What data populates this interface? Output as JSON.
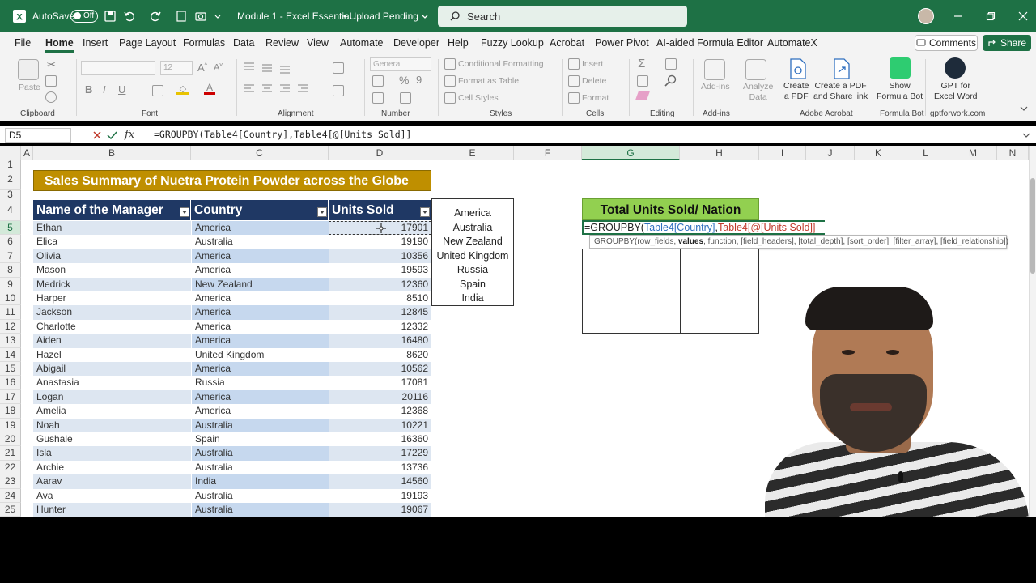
{
  "titlebar": {
    "autosave_label": "AutoSave",
    "autosave_state": "Off",
    "doc_title": "Module 1 - Excel Essential...",
    "upload_status": "Upload Pending",
    "search_placeholder": "Search"
  },
  "menu": {
    "items": [
      "File",
      "Home",
      "Insert",
      "Page Layout",
      "Formulas",
      "Data",
      "Review",
      "View",
      "Automate",
      "Developer",
      "Help",
      "Fuzzy Lookup",
      "Acrobat",
      "Power Pivot",
      "AI-aided Formula Editor",
      "AutomateX"
    ],
    "active": "Home",
    "comments_label": "Comments",
    "share_label": "Share"
  },
  "ribbon": {
    "paste": "Paste",
    "font_name": "",
    "font_size": "12",
    "number_format": "General",
    "conditional_formatting": "Conditional Formatting",
    "format_as_table": "Format as Table",
    "cell_styles": "Cell Styles",
    "insert": "Insert",
    "delete": "Delete",
    "format": "Format",
    "addins": "Add-ins",
    "analyze_data": [
      "Analyze",
      "Data"
    ],
    "create_pdf": [
      "Create",
      "a PDF"
    ],
    "create_pdf_share": [
      "Create a PDF",
      "and Share link"
    ],
    "show_formula_bot": [
      "Show",
      "Formula Bot"
    ],
    "gpt_excel_word": [
      "GPT for",
      "Excel Word"
    ],
    "groups": {
      "clipboard": "Clipboard",
      "font": "Font",
      "alignment": "Alignment",
      "number": "Number",
      "styles": "Styles",
      "cells": "Cells",
      "editing": "Editing",
      "addins": "Add-ins",
      "adobe": "Adobe Acrobat",
      "formulabot": "Formula Bot",
      "gptforwork": "gptforwork.com"
    }
  },
  "formula_bar": {
    "name_box": "D5",
    "fx": "fx",
    "formula": "=GROUPBY(Table4[Country],Table4[@[Units Sold]]"
  },
  "columns": [
    "A",
    "B",
    "C",
    "D",
    "E",
    "F",
    "G",
    "H",
    "I",
    "J",
    "K",
    "L",
    "M",
    "N"
  ],
  "rows": [
    "1",
    "2",
    "3",
    "4",
    "5",
    "6",
    "7",
    "8",
    "9",
    "10",
    "11",
    "12",
    "13",
    "14",
    "15",
    "16",
    "17",
    "18",
    "19",
    "20",
    "21",
    "22",
    "23",
    "24",
    "25"
  ],
  "sheet": {
    "title": "Sales Summary of Nuetra Protein Powder across the Globe",
    "headers": [
      "Name of the Manager",
      "Country",
      "Units Sold"
    ],
    "table": [
      [
        "Ethan",
        "America",
        "17901"
      ],
      [
        "Elica",
        "Australia",
        "19190"
      ],
      [
        "Olivia",
        "America",
        "10356"
      ],
      [
        "Mason",
        "America",
        "19593"
      ],
      [
        "Medrick",
        "New Zealand",
        "12360"
      ],
      [
        "Harper",
        "America",
        "8510"
      ],
      [
        "Jackson",
        "America",
        "12845"
      ],
      [
        "Charlotte",
        "America",
        "12332"
      ],
      [
        "Aiden",
        "America",
        "16480"
      ],
      [
        "Hazel",
        "United Kingdom",
        "8620"
      ],
      [
        "Abigail",
        "America",
        "10562"
      ],
      [
        "Anastasia",
        "Russia",
        "17081"
      ],
      [
        "Logan",
        "America",
        "20116"
      ],
      [
        "Amelia",
        "America",
        "12368"
      ],
      [
        "Noah",
        "Australia",
        "10221"
      ],
      [
        "Gushale",
        "Spain",
        "16360"
      ],
      [
        "Isla",
        "Australia",
        "17229"
      ],
      [
        "Archie",
        "Australia",
        "13736"
      ],
      [
        "Aarav",
        "India",
        "14560"
      ],
      [
        "Ava",
        "Australia",
        "19193"
      ],
      [
        "Hunter",
        "Australia",
        "19067"
      ]
    ],
    "country_list": [
      "America",
      "Australia",
      "New Zealand",
      "United Kingdom",
      "Russia",
      "Spain",
      "India"
    ],
    "total_title": "Total Units Sold/ Nation",
    "formula_cell": {
      "prefix": "=GROUPBY(",
      "arg1": "Table4[Country]",
      "comma": ",",
      "arg2": "Table4[@[Units Sold]]"
    },
    "tooltip": {
      "fn": "GROUPBY(row_fields, ",
      "current": "values",
      "rest": ", function, [field_headers], [total_depth], [sort_order], [filter_array], [field_relationship])"
    }
  },
  "colors": {
    "excel_green": "#1e7145",
    "banner_gold": "#bf8f00",
    "header_navy": "#1f3864",
    "total_green": "#92d050",
    "formula_blue": "#2f6fbf",
    "formula_red": "#c0392b"
  }
}
